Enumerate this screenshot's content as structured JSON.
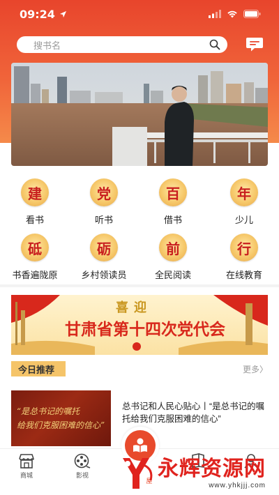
{
  "status_bar": {
    "time": "09:24"
  },
  "search": {
    "placeholder": "搜书名"
  },
  "categories": [
    {
      "seal": "建",
      "label": "看书"
    },
    {
      "seal": "党",
      "label": "听书"
    },
    {
      "seal": "百",
      "label": "借书"
    },
    {
      "seal": "年",
      "label": "少儿"
    },
    {
      "seal": "砥",
      "label": "书香遍陇原"
    },
    {
      "seal": "砺",
      "label": "乡村领读员"
    },
    {
      "seal": "前",
      "label": "全民阅读"
    },
    {
      "seal": "行",
      "label": "在线教育"
    }
  ],
  "promo": {
    "line1": "喜迎",
    "line2": "甘肃省第十四次党代会"
  },
  "recommend": {
    "tag": "今日推荐",
    "more": "更多〉"
  },
  "article": {
    "thumb_line1": "“是总书记的嘱托",
    "thumb_line2": "给我们克服困难的信心”",
    "title": "总书记和人民心贴心丨“是总书记的嘱托给我们克服困难的信心”"
  },
  "tabs": [
    {
      "label": "商城",
      "icon": "shop-icon"
    },
    {
      "label": "影视",
      "icon": "film-reel-icon"
    },
    {
      "label": "屋",
      "icon": "house-icon"
    }
  ],
  "watermark": {
    "text": "永辉资源网",
    "url": "www.yhkjjj.com"
  },
  "colors": {
    "brand_red": "#e8452c",
    "seal_text": "#c81e1e",
    "seal_gold": "#f6c86a",
    "tag_gold": "#f5c469"
  }
}
